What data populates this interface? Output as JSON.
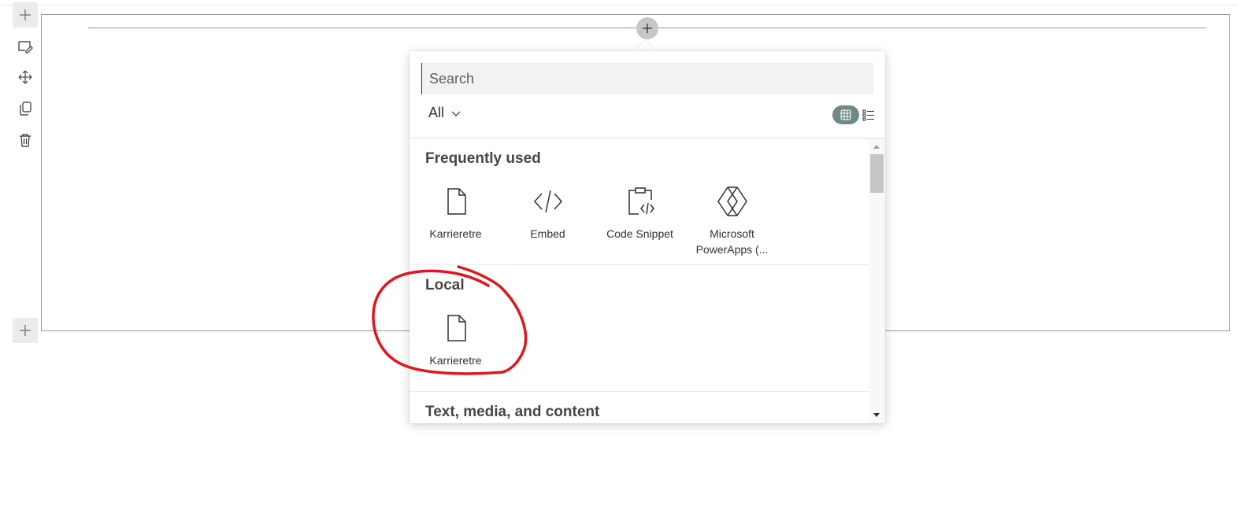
{
  "canvas": {
    "toolbar": [
      {
        "name": "add-section-top-button",
        "icon": "plus-icon"
      },
      {
        "name": "edit-section-button",
        "icon": "edit-icon"
      },
      {
        "name": "move-section-button",
        "icon": "move-icon"
      },
      {
        "name": "duplicate-section-button",
        "icon": "copy-icon"
      },
      {
        "name": "delete-section-button",
        "icon": "trash-icon"
      },
      {
        "name": "add-section-bottom-button",
        "icon": "plus-icon"
      }
    ],
    "add_webpart_icon": "plus-icon"
  },
  "toolbox": {
    "search_placeholder": "Search",
    "filter_label": "All",
    "filter_icon": "chevron-down-icon",
    "view_grid_icon": "grid-view-icon",
    "view_list_icon": "list-view-icon",
    "categories": [
      {
        "title": "Frequently used",
        "items": [
          {
            "label": "Karrieretre",
            "icon": "page-icon"
          },
          {
            "label": "Embed",
            "icon": "code-icon"
          },
          {
            "label": "Code Snippet",
            "icon": "clipboard-code-icon"
          },
          {
            "label": "Microsoft PowerApps (...",
            "icon": "powerapps-icon"
          }
        ]
      },
      {
        "title": "Local",
        "items": [
          {
            "label": "Karrieretre",
            "icon": "page-icon"
          }
        ]
      },
      {
        "title": "Text, media, and content",
        "items": []
      }
    ]
  },
  "colors": {
    "accent": "#6f8a84",
    "annotation": "#e0161c",
    "frame": "#8a9a98"
  }
}
